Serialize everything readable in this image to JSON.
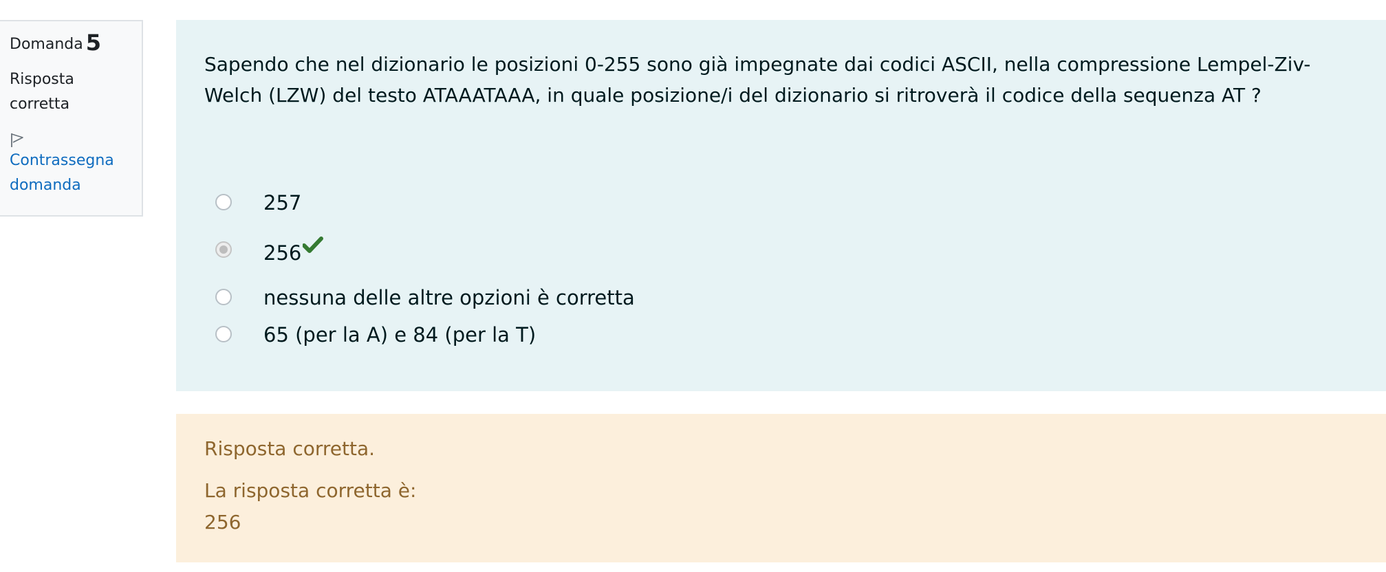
{
  "info": {
    "label": "Domanda",
    "number": "5",
    "state_line1": "Risposta",
    "state_line2": "corretta",
    "flag_line1": "Contrassegna",
    "flag_line2": "domanda",
    "flag_icon": "flag-icon"
  },
  "question": {
    "text": "Sapendo che nel dizionario le posizioni 0-255 sono già impegnate dai codici ASCII, nella compressione Lempel-Ziv-Welch (LZW) del testo ATAAATAAA, in quale posizione/i del dizionario si ritroverà il codice della sequenza AT ?"
  },
  "options": [
    {
      "label": "257",
      "selected": false
    },
    {
      "label": "256",
      "selected": true,
      "correct": true
    },
    {
      "label": "nessuna delle altre opzioni è corretta",
      "selected": false
    },
    {
      "label": "65 (per la A) e 84 (per la T)",
      "selected": false
    }
  ],
  "outcome": {
    "feedback": "Risposta corretta.",
    "right_answer_label": "La risposta corretta è:",
    "right_answer_value": "256"
  },
  "colors": {
    "formulation_bg": "#e7f3f5",
    "outcome_bg": "#fcefdc",
    "outcome_text": "#8e662e",
    "link": "#0f6cbf",
    "correct_check": "#357a32"
  }
}
